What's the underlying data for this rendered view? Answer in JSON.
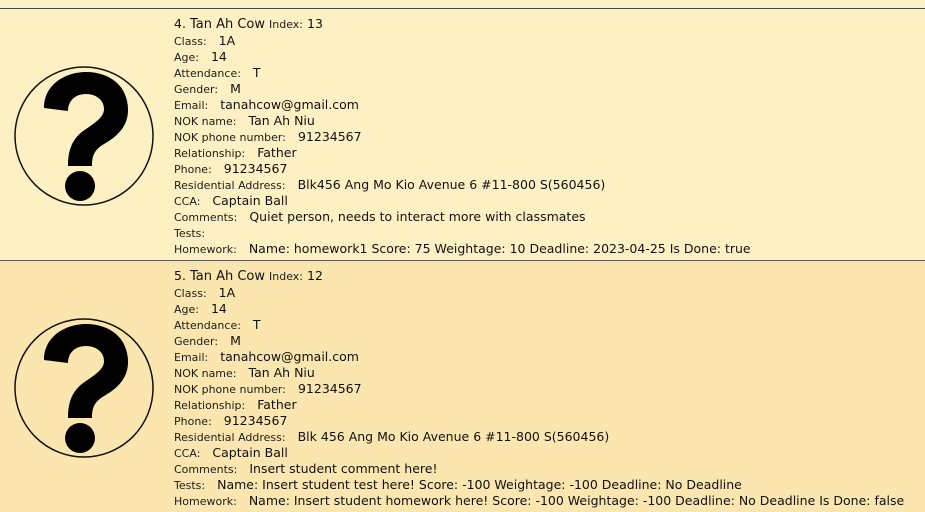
{
  "top_strip": {
    "text": ""
  },
  "labels": {
    "index": "Index:",
    "class": "Class:",
    "age": "Age:",
    "attendance": "Attendance:",
    "gender": "Gender:",
    "email": "Email:",
    "nok_name": "NOK name:",
    "nok_phone": "NOK phone number:",
    "relationship": "Relationship:",
    "phone": "Phone:",
    "address": "Residential Address:",
    "cca": "CCA:",
    "comments": "Comments:",
    "tests": "Tests:",
    "homework": "Homework:"
  },
  "students": [
    {
      "number": "4.",
      "name": "Tan Ah Cow",
      "index": "13",
      "class": "1A",
      "age": "14",
      "attendance": "T",
      "gender": "M",
      "email": "tanahcow@gmail.com",
      "nok_name": "Tan Ah Niu",
      "nok_phone": "91234567",
      "relationship": "Father",
      "phone": "91234567",
      "address": "Blk456 Ang Mo Kio Avenue 6 #11-800 S(560456)",
      "cca": "Captain Ball",
      "comments": "Quiet person, needs to interact more with classmates",
      "tests": "",
      "homework": "Name: homework1 Score: 75 Weightage: 10 Deadline: 2023-04-25 Is Done: true"
    },
    {
      "number": "5.",
      "name": "Tan Ah Cow",
      "index": "12",
      "class": "1A",
      "age": "14",
      "attendance": "T",
      "gender": "M",
      "email": "tanahcow@gmail.com",
      "nok_name": "Tan Ah Niu",
      "nok_phone": "91234567",
      "relationship": "Father",
      "phone": "91234567",
      "address": "Blk 456 Ang Mo Kio Avenue 6 #11-800 S(560456)",
      "cca": "Captain Ball",
      "comments": "Insert student comment here!",
      "tests": "Name: Insert student test here! Score: -100 Weightage: -100 Deadline: No Deadline",
      "homework": "Name: Insert student homework here! Score: -100 Weightage: -100 Deadline: No Deadline Is Done: false"
    }
  ],
  "icons": {
    "avatar": "question-mark-placeholder-icon"
  },
  "colors": {
    "card_a": "#fdf1c4",
    "card_b": "#fae6ae",
    "divider": "#4a4a4a"
  }
}
